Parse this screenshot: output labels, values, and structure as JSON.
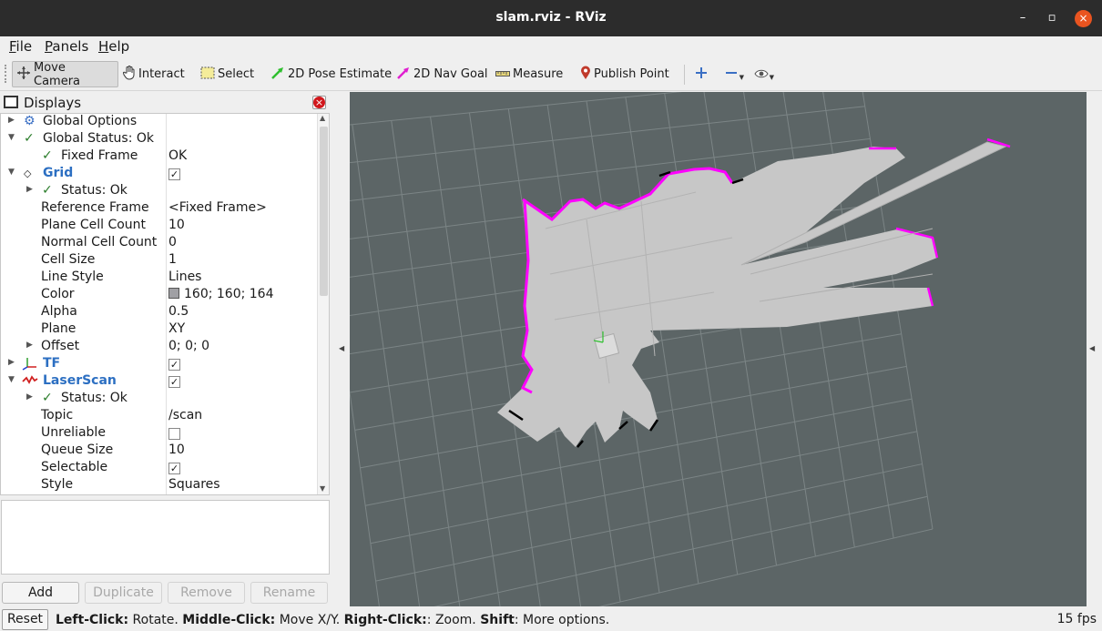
{
  "window": {
    "title": "slam.rviz - RViz",
    "minimize_glyph": "–",
    "maximize_glyph": "▫",
    "close_glyph": "×"
  },
  "menu": [
    "File",
    "Panels",
    "Help"
  ],
  "toolbar": {
    "move_camera": "Move Camera",
    "interact": "Interact",
    "select": "Select",
    "pose_estimate": "2D Pose Estimate",
    "nav_goal": "2D Nav Goal",
    "measure": "Measure",
    "publish_point": "Publish Point",
    "icons": [
      "move-camera-icon",
      "hand-icon",
      "select-icon",
      "pose-arrow-icon",
      "nav-arrow-icon",
      "ruler-icon",
      "map-pin-icon",
      "zoom-plus-icon",
      "zoom-minus-icon",
      "eye-icon"
    ]
  },
  "displays": {
    "title": "Displays",
    "rows": {
      "global_options": "Global Options",
      "global_status": "Global Status: Ok",
      "fixed_frame_key": "Fixed Frame",
      "fixed_frame_val": "OK",
      "grid": "Grid",
      "grid_status": "Status: Ok",
      "reference_frame_key": "Reference Frame",
      "reference_frame_val": "<Fixed Frame>",
      "plane_cell_count_key": "Plane Cell Count",
      "plane_cell_count_val": "10",
      "normal_cell_count_key": "Normal Cell Count",
      "normal_cell_count_val": "0",
      "cell_size_key": "Cell Size",
      "cell_size_val": "1",
      "line_style_key": "Line Style",
      "line_style_val": "Lines",
      "color_key": "Color",
      "color_val": "160; 160; 164",
      "alpha_key": "Alpha",
      "alpha_val": "0.5",
      "plane_key": "Plane",
      "plane_val": "XY",
      "offset_key": "Offset",
      "offset_val": "0; 0; 0",
      "tf": "TF",
      "laserscan": "LaserScan",
      "laserscan_status": "Status: Ok",
      "topic_key": "Topic",
      "topic_val": "/scan",
      "unreliable_key": "Unreliable",
      "queue_size_key": "Queue Size",
      "queue_size_val": "10",
      "selectable_key": "Selectable",
      "style_key": "Style",
      "style_val": "Squares"
    },
    "check_glyph": "✓",
    "grid_color": "#a0a0a4",
    "status_ok_color": "#2a7d2a",
    "display_name_color": "#2c6fc2"
  },
  "buttons": {
    "add": "Add",
    "duplicate": "Duplicate",
    "remove": "Remove",
    "rename": "Rename"
  },
  "statusbar": {
    "reset": "Reset",
    "left_click_label": "Left-Click:",
    "left_click_text": " Rotate. ",
    "middle_click_label": "Middle-Click:",
    "middle_click_text": " Move X/Y. ",
    "right_click_label": "Right-Click:",
    "right_click_text": ": Zoom. ",
    "shift_label": "Shift",
    "shift_text": ": More options.",
    "fps": "15 fps"
  },
  "viewport": {
    "background": "#5c6566",
    "grid_line_color": "#7c8586",
    "map_free_color": "#c8c8c8",
    "scan_color": "#ff00ff",
    "obstacle_color": "#000000"
  }
}
